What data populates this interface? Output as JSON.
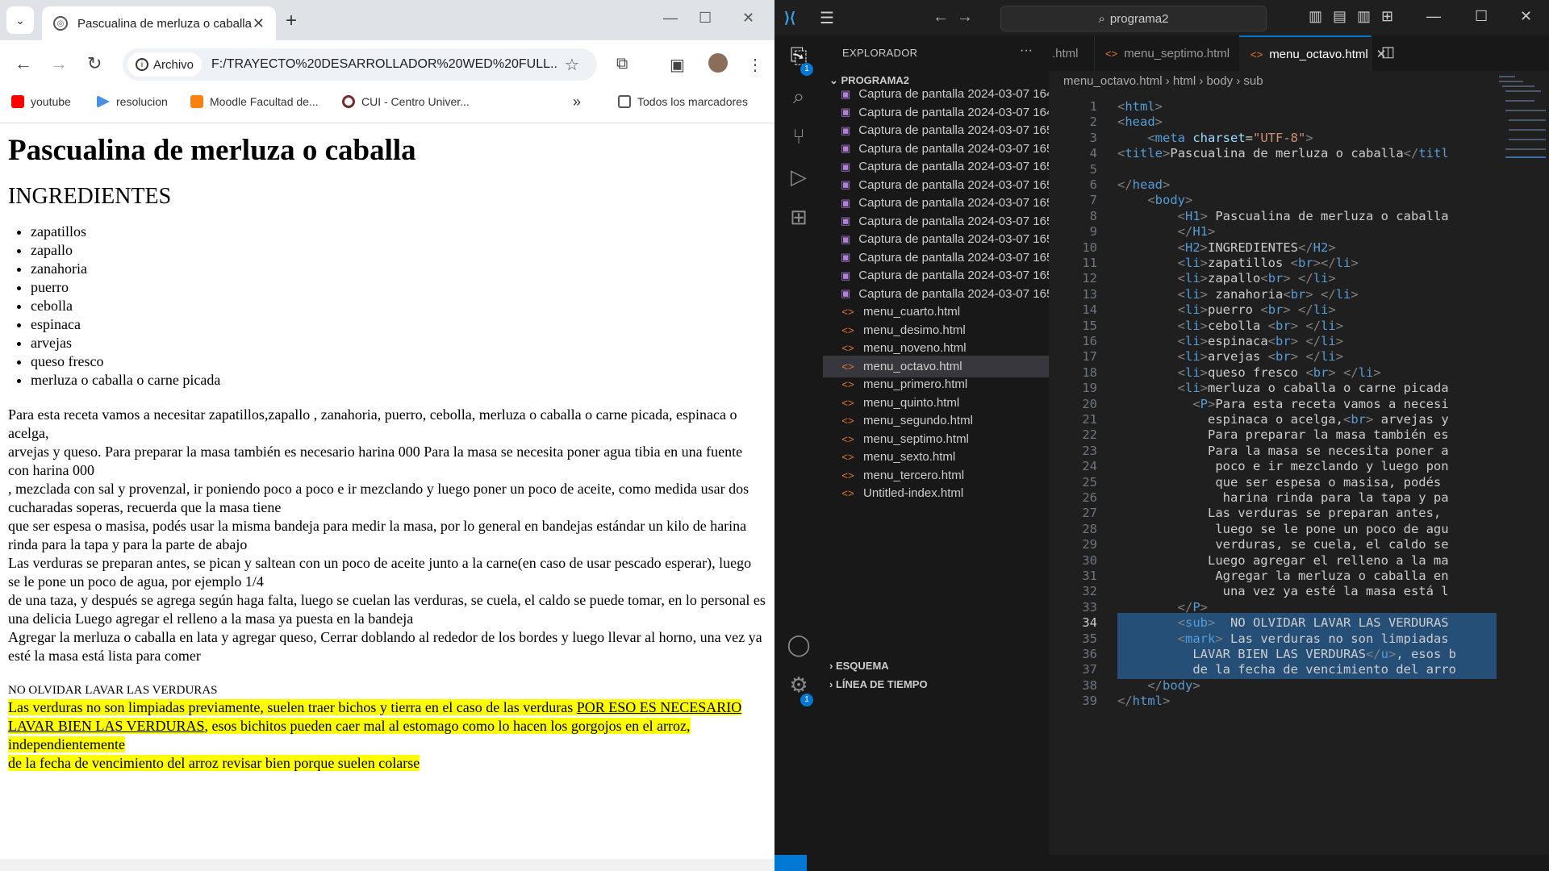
{
  "chrome": {
    "tab_title": "Pascualina de merluza o caballa",
    "new_tab_label": "+",
    "address_chip": "Archivo",
    "url": "F:/TRAYECTO%20DESARROLLADOR%20WED%20FULL...",
    "bookmarks": [
      "youtube",
      "resolucion",
      "Moodle Facultad de...",
      "CUI - Centro Univer..."
    ],
    "bookmarks_overflow": "»",
    "all_bookmarks": "Todos los marcadores"
  },
  "page": {
    "h1": "Pascualina de merluza o caballa",
    "h2": "INGREDIENTES",
    "ingredients": [
      "zapatillos",
      "zapallo",
      "zanahoria",
      "puerro",
      "cebolla",
      "espinaca",
      "arvejas",
      "queso fresco",
      "merluza o caballa o carne picada"
    ],
    "paragraph_lines": [
      "Para esta receta vamos a necesitar zapatillos,zapallo , zanahoria, puerro, cebolla, merluza o caballa o carne picada, espinaca o acelga,",
      "arvejas y queso. Para preparar la masa también es necesario harina 000 Para la masa se necesita poner agua tibia en una fuente con harina 000",
      ", mezclada con sal y provenzal, ir poniendo poco a poco e ir mezclando y luego poner un poco de aceite, como medida usar dos cucharadas soperas, recuerda que la masa tiene",
      "que ser espesa o masisa, podés usar la misma bandeja para medir la masa, por lo general en bandejas estándar un kilo de harina rinda para la tapa y para la parte de abajo",
      "Las verduras se preparan antes, se pican y saltean con un poco de aceite junto a la carne(en caso de usar pescado esperar), luego se le pone un poco de agua, por ejemplo 1/4",
      "de una taza, y después se agrega según haga falta, luego se cuelan las verduras, se cuela, el caldo se puede tomar, en lo personal es una delicia Luego agregar el relleno a la masa ya puesta en la bandeja",
      "Agregar la merluza o caballa en lata y agregar queso, Cerrar doblando al rededor de los bordes y luego llevar al horno, una vez ya esté la masa está lista para comer"
    ],
    "sub_text": "NO OLVIDAR LAVAR LAS VERDURAS",
    "mark_1": "Las verduras no son limpiadas previamente, suelen traer bichos y tierra en el caso de las verduras ",
    "mark_u1": "POR ESO ES NECESARIO",
    "mark_u2": "LAVAR BIEN LAS VERDURAS",
    "mark_2": ", esos bichitos pueden caer mal al estomago como lo hacen los gorgojos en el arroz, independientemente",
    "mark_3": "de la fecha de vencimiento del arroz revisar bien porque suelen colarse"
  },
  "vscode": {
    "search": "programa2",
    "explorer_title": "EXPLORADOR",
    "explorer_more": "···",
    "folder": "PROGRAMA2",
    "files": [
      {
        "name": "Captura de pantalla 2024-03-07 164...",
        "type": "img"
      },
      {
        "name": "Captura de pantalla 2024-03-07 164...",
        "type": "img"
      },
      {
        "name": "Captura de pantalla 2024-03-07 165...",
        "type": "img"
      },
      {
        "name": "Captura de pantalla 2024-03-07 165...",
        "type": "img"
      },
      {
        "name": "Captura de pantalla 2024-03-07 165...",
        "type": "img"
      },
      {
        "name": "Captura de pantalla 2024-03-07 165...",
        "type": "img"
      },
      {
        "name": "Captura de pantalla 2024-03-07 165...",
        "type": "img"
      },
      {
        "name": "Captura de pantalla 2024-03-07 165...",
        "type": "img"
      },
      {
        "name": "Captura de pantalla 2024-03-07 165...",
        "type": "img"
      },
      {
        "name": "Captura de pantalla 2024-03-07 165...",
        "type": "img"
      },
      {
        "name": "Captura de pantalla 2024-03-07 165...",
        "type": "img"
      },
      {
        "name": "Captura de pantalla 2024-03-07 165...",
        "type": "img"
      },
      {
        "name": "menu_cuarto.html",
        "type": "html"
      },
      {
        "name": "menu_desimo.html",
        "type": "html"
      },
      {
        "name": "menu_noveno.html",
        "type": "html"
      },
      {
        "name": "menu_octavo.html",
        "type": "html",
        "selected": true
      },
      {
        "name": "menu_primero.html",
        "type": "html"
      },
      {
        "name": "menu_quinto.html",
        "type": "html"
      },
      {
        "name": "menu_segundo.html",
        "type": "html"
      },
      {
        "name": "menu_septimo.html",
        "type": "html"
      },
      {
        "name": "menu_sexto.html",
        "type": "html"
      },
      {
        "name": "menu_tercero.html",
        "type": "html"
      },
      {
        "name": "Untitled-index.html",
        "type": "html"
      }
    ],
    "outline": "ESQUEMA",
    "timeline": "LÍNEA DE TIEMPO",
    "tabs": [
      ".html",
      "menu_septimo.html",
      "menu_octavo.html"
    ],
    "breadcrumb": "menu_octavo.html › html › body › sub",
    "current_line": 34,
    "code_lines": [
      "<html>",
      "<head>",
      "    <meta charset=\"UTF-8\">",
      "<title>Pascualina de merluza o caballa</titl",
      "",
      "</head>",
      "    <body>",
      "        <H1> Pascualina de merluza o caballa",
      "        </H1>",
      "        <H2>INGREDIENTES</H2>",
      "        <li>zapatillos <br></li>",
      "        <li>zapallo<br> </li>",
      "        <li> zanahoria<br> </li>",
      "        <li>puerro <br> </li>",
      "        <li>cebolla <br> </li>",
      "        <li>espinaca<br> </li>",
      "        <li>arvejas <br> </li>",
      "        <li>queso fresco <br> </li>",
      "        <li>merluza o caballa o carne picada",
      "          <P>Para esta receta vamos a necesi",
      "            espinaca o acelga,<br> arvejas y",
      "            Para preparar la masa también es",
      "            Para la masa se necesita poner a",
      "             poco e ir mezclando y luego pon",
      "             que ser espesa o masisa, podés",
      "              harina rinda para la tapa y pa",
      "            Las verduras se preparan antes,",
      "             luego se le pone un poco de agu",
      "             verduras, se cuela, el caldo se",
      "            Luego agregar el relleno a la ma",
      "             Agregar la merluza o caballa en",
      "              una vez ya esté la masa está l",
      "        </P>",
      "        <sub>  NO OLVIDAR LAVAR LAS VERDURAS",
      "        <mark> Las verduras no son limpiadas",
      "          LAVAR BIEN LAS VERDURAS</u>, esos b",
      "          de la fecha de vencimiento del arro",
      "    </body>",
      "</html>"
    ],
    "badge_count": "1"
  }
}
